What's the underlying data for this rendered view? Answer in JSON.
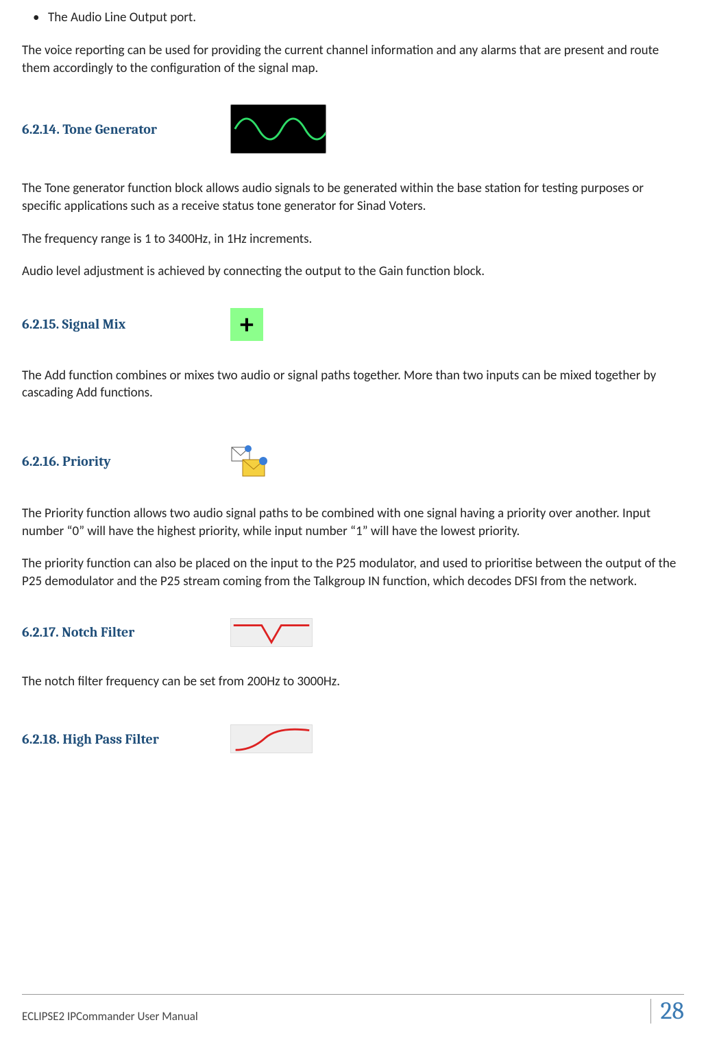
{
  "intro_bullet": "The Audio Line Output port.",
  "intro_paragraph": " The voice reporting can be used for providing the current channel information and any alarms that are present and route them accordingly to the configuration of the signal map.",
  "sections": {
    "tone_generator": {
      "heading": "6.2.14. Tone Generator",
      "p1": "The Tone generator function block allows audio signals to be generated within the base station for testing purposes or specific applications such as a receive status tone generator for Sinad Voters.",
      "p2": "The frequency range is 1 to 3400Hz, in 1Hz increments.",
      "p3": "Audio level adjustment is achieved by connecting the output to the Gain function block."
    },
    "signal_mix": {
      "heading": "6.2.15. Signal Mix",
      "p1": "The Add function combines or mixes two audio or signal paths together.  More than two inputs can be mixed together by cascading Add functions."
    },
    "priority": {
      "heading": "6.2.16. Priority",
      "p1": "The Priority function allows two audio signal paths to be combined with one signal having a priority over another.  Input number “0” will have the highest priority, while input number “1” will have the lowest priority.",
      "p2": "The priority function can also be placed on the input to the P25 modulator, and used to prioritise between the output of the P25 demodulator and the P25 stream coming from the Talkgroup IN function, which decodes DFSI from the network."
    },
    "notch_filter": {
      "heading": "6.2.17. Notch Filter",
      "p1": "The notch filter frequency can be set from 200Hz to 3000Hz."
    },
    "high_pass": {
      "heading": "6.2.18. High Pass Filter"
    }
  },
  "footer": {
    "left": "ECLIPSE2 IPCommander User Manual",
    "page": "28"
  }
}
